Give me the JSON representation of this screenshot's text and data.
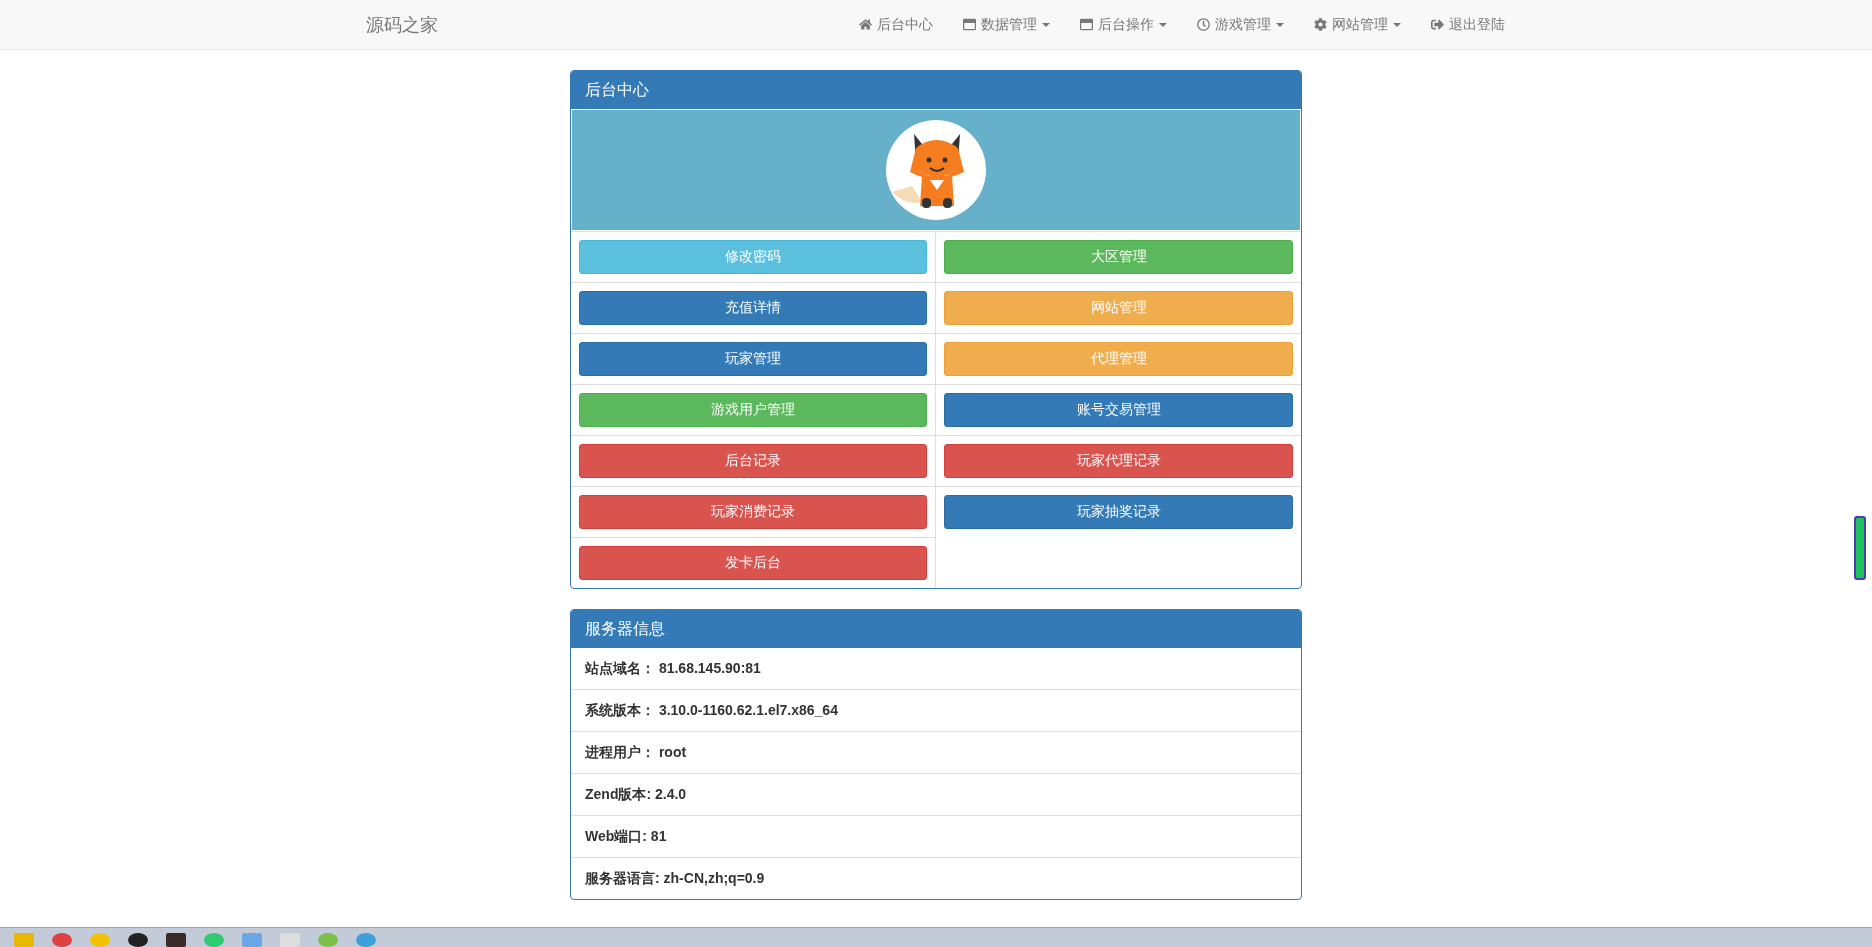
{
  "brand": "源码之家",
  "nav": [
    {
      "label": "后台中心",
      "kind": "home",
      "dropdown": false
    },
    {
      "label": "数据管理",
      "kind": "window",
      "dropdown": true
    },
    {
      "label": "后台操作",
      "kind": "window",
      "dropdown": true
    },
    {
      "label": "游戏管理",
      "kind": "clock",
      "dropdown": true
    },
    {
      "label": "网站管理",
      "kind": "gear",
      "dropdown": true
    },
    {
      "label": "退出登陆",
      "kind": "logout",
      "dropdown": false
    }
  ],
  "admin_panel": {
    "title": "后台中心",
    "buttons": [
      {
        "label": "修改密码",
        "kind": "info"
      },
      {
        "label": "大区管理",
        "kind": "success"
      },
      {
        "label": "充值详情",
        "kind": "primary"
      },
      {
        "label": "网站管理",
        "kind": "warning"
      },
      {
        "label": "玩家管理",
        "kind": "primary"
      },
      {
        "label": "代理管理",
        "kind": "warning"
      },
      {
        "label": "游戏用户管理",
        "kind": "success"
      },
      {
        "label": "账号交易管理",
        "kind": "primary"
      },
      {
        "label": "后台记录",
        "kind": "danger"
      },
      {
        "label": "玩家代理记录",
        "kind": "danger"
      },
      {
        "label": "玩家消费记录",
        "kind": "danger"
      },
      {
        "label": "玩家抽奖记录",
        "kind": "primary"
      },
      {
        "label": "发卡后台",
        "kind": "danger"
      }
    ]
  },
  "server_panel": {
    "title": "服务器信息",
    "rows": [
      "站点域名：  81.68.145.90:81",
      "系统版本：  3.10.0-1160.62.1.el7.x86_64",
      "进程用户：  root",
      "Zend版本: 2.4.0",
      "Web端口: 81",
      "服务器语言: zh-CN,zh;q=0.9"
    ]
  }
}
